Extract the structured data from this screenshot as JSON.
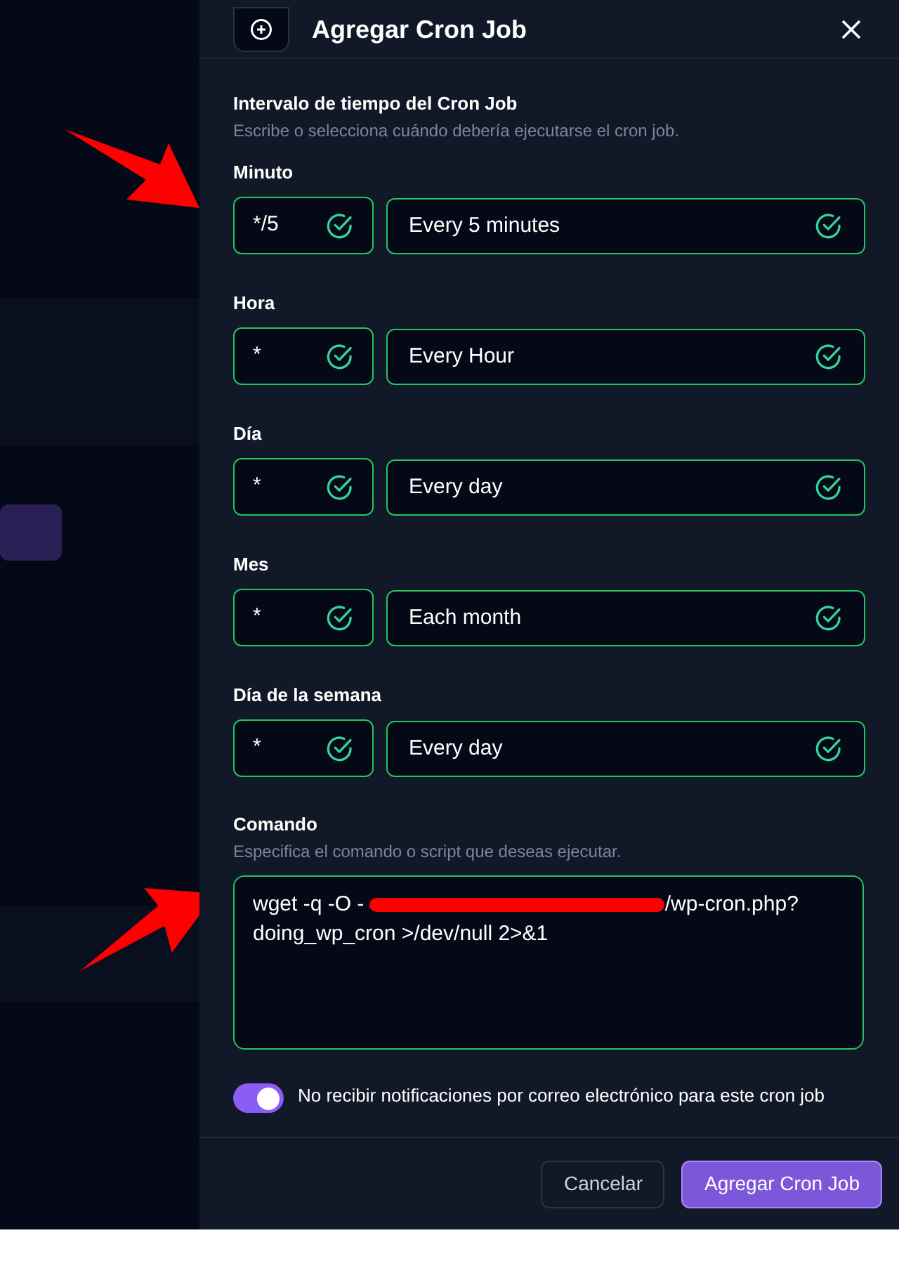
{
  "dialog": {
    "title": "Agregar Cron Job"
  },
  "interval": {
    "title": "Intervalo de tiempo del Cron Job",
    "description": "Escribe o selecciona cuándo debería ejecutarse el cron job."
  },
  "fields": [
    {
      "label": "Minuto",
      "value": "*/5",
      "description": "Every 5 minutes",
      "valid": true
    },
    {
      "label": "Hora",
      "value": "*",
      "description": "Every Hour",
      "valid": true
    },
    {
      "label": "Día",
      "value": "*",
      "description": "Every day",
      "valid": true
    },
    {
      "label": "Mes",
      "value": "*",
      "description": "Each month",
      "valid": true
    },
    {
      "label": "Día de la semana",
      "value": "*",
      "description": "Every day",
      "valid": true
    }
  ],
  "command": {
    "label": "Comando",
    "description": "Especifica el comando o script que deseas ejecutar.",
    "value_start": "wget -q -O -",
    "value_end": "/wp-cron.php? doing_wp_cron >/dev/null 2>&1"
  },
  "notifications": {
    "label": "No recibir notificaciones por correo electrónico para este cron job",
    "on": true
  },
  "buttons": [
    {
      "label": "Cancelar",
      "kind": "secondary"
    },
    {
      "label": "Agregar Cron Job",
      "kind": "primary"
    }
  ]
}
